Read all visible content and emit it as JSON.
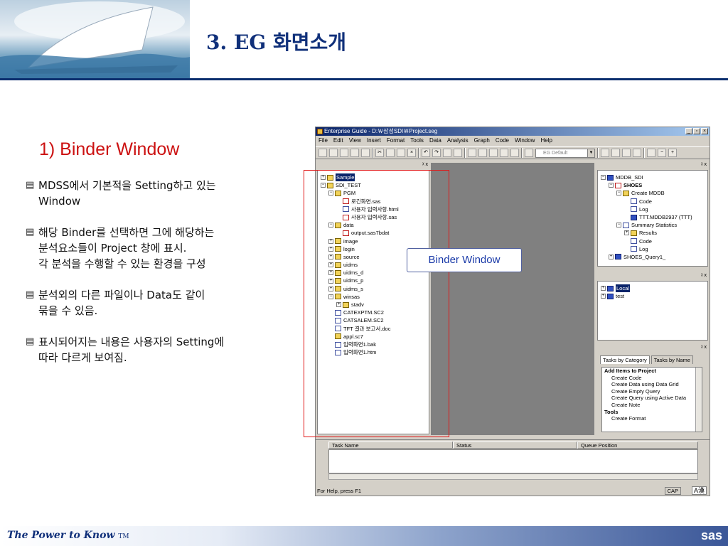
{
  "slide": {
    "title": "3. EG 화면소개",
    "section_title": "1) Binder Window",
    "bullets": [
      "MDSS에서 기본적을 Setting하고 있는\nWindow",
      "해당 Binder를 선택하면 그에 해당하는\n분석요소들이 Project 창에 표시.\n각 분석을 수행할 수 있는 환경을 구성",
      "분석외의 다른 파일이나 Data도 같이\n묶을 수 있음.",
      "표시되어지는 내용은 사용자의 Setting에\n따라 다르게 보여짐."
    ],
    "footer": {
      "text": "The Power to Know",
      "tm": "TM",
      "logo": "sas"
    },
    "callout": "Binder Window"
  },
  "window": {
    "title": "Enterprise Guide - D:￦삼성SDI￦Project.seg",
    "menu": [
      "File",
      "Edit",
      "View",
      "Insert",
      "Format",
      "Tools",
      "Data",
      "Analysis",
      "Graph",
      "Code",
      "Window",
      "Help"
    ],
    "combo_value": "EG Default",
    "binder_tree": [
      {
        "label": "Sample",
        "selected": true,
        "pm": "⊞"
      },
      {
        "label": "SDI_TEST",
        "pm": "⊟"
      },
      {
        "label": "PGM",
        "indent": 1,
        "pm": "⊟"
      },
      {
        "label": "로긴화면.sas",
        "indent": 2,
        "icon": "red"
      },
      {
        "label": "사용자 입력사항.html",
        "indent": 2,
        "icon": "file"
      },
      {
        "label": "사용자 입력사항.sas",
        "indent": 2,
        "icon": "red"
      },
      {
        "label": "data",
        "indent": 1,
        "pm": "⊟"
      },
      {
        "label": "output.sas7bdat",
        "indent": 2,
        "icon": "red"
      },
      {
        "label": "image",
        "indent": 1,
        "pm": "⊞"
      },
      {
        "label": "login",
        "indent": 1,
        "pm": "⊞"
      },
      {
        "label": "source",
        "indent": 1,
        "pm": "⊞"
      },
      {
        "label": "uidms",
        "indent": 1,
        "pm": "⊞"
      },
      {
        "label": "uidms_d",
        "indent": 1,
        "pm": "⊞"
      },
      {
        "label": "uidms_p",
        "indent": 1,
        "pm": "⊞"
      },
      {
        "label": "uidms_s",
        "indent": 1,
        "pm": "⊞"
      },
      {
        "label": "winsas",
        "indent": 1,
        "pm": "⊟"
      },
      {
        "label": "stadv",
        "indent": 2,
        "pm": "⊞"
      },
      {
        "label": "CATEXPTM.SC2",
        "indent": 1,
        "icon": "file"
      },
      {
        "label": "CATSALEM.SC2",
        "indent": 1,
        "icon": "file"
      },
      {
        "label": "TFT 결과 보고서.doc",
        "indent": 1,
        "icon": "file"
      },
      {
        "label": "appl.sc7",
        "indent": 1
      },
      {
        "label": "입력화면1.bak",
        "indent": 1,
        "icon": "file"
      },
      {
        "label": "입력화면1.htm",
        "indent": 1,
        "icon": "file"
      }
    ],
    "project_tree": [
      {
        "label": "MDDB_SDI",
        "pm": "⊟",
        "icon": "db"
      },
      {
        "label": "SHOES",
        "indent": 1,
        "pm": "⊟",
        "bold": true,
        "icon": "red"
      },
      {
        "label": "Create MDDB",
        "indent": 2,
        "pm": "⊟"
      },
      {
        "label": "Code",
        "indent": 3,
        "icon": "file"
      },
      {
        "label": "Log",
        "indent": 3,
        "icon": "file"
      },
      {
        "label": "TTT.MDDB2937 (TTT)",
        "indent": 3,
        "icon": "db"
      },
      {
        "label": "Summary Statistics",
        "indent": 2,
        "pm": "⊟",
        "icon": "file"
      },
      {
        "label": "Results",
        "indent": 3,
        "pm": "⊞"
      },
      {
        "label": "Code",
        "indent": 3,
        "icon": "file"
      },
      {
        "label": "Log",
        "indent": 3,
        "icon": "file"
      },
      {
        "label": "SHOES_Query1_",
        "indent": 1,
        "pm": "⊞",
        "icon": "db"
      }
    ],
    "server_tree": [
      {
        "label": "Local",
        "pm": "⊞",
        "icon": "db",
        "selected": true
      },
      {
        "label": "test",
        "pm": "⊞",
        "icon": "db"
      }
    ],
    "tabs": [
      "Tasks by Category",
      "Tasks by Name"
    ],
    "task_list": [
      {
        "label": "Add Items to Project",
        "head": true
      },
      {
        "label": "Create Code"
      },
      {
        "label": "Create Data using Data Grid"
      },
      {
        "label": "Create Empty Query"
      },
      {
        "label": "Create Query using Active Data"
      },
      {
        "label": "Create Note"
      },
      {
        "label": "Tools",
        "head": true
      },
      {
        "label": "Create Format"
      }
    ],
    "grid_columns": [
      "Task Name",
      "Status",
      "Queue Position"
    ],
    "status_text": "For Help, press F1",
    "status_cap": "CAP",
    "status_ime": "A漢"
  }
}
